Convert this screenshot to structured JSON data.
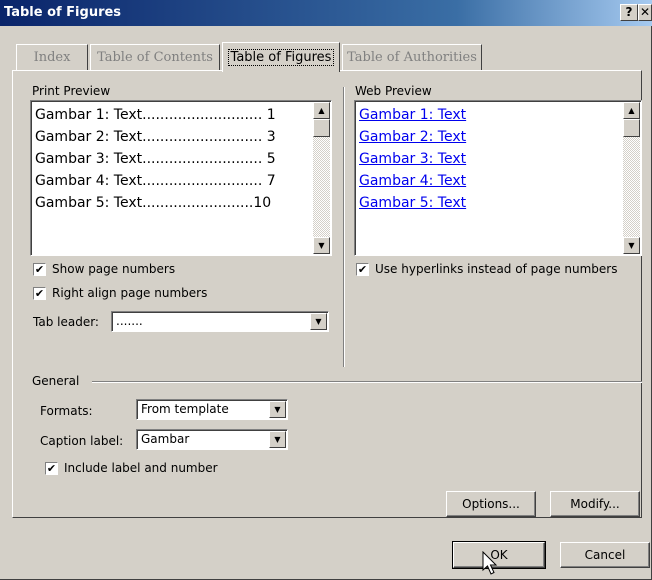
{
  "window": {
    "title": "Table of Figures",
    "help_glyph": "?",
    "close_glyph": "✕"
  },
  "tabs": [
    {
      "label": "Index",
      "active": false
    },
    {
      "label": "Table of Contents",
      "active": false
    },
    {
      "label": "Table of Figures",
      "active": true
    },
    {
      "label": "Table of Authorities",
      "active": false
    }
  ],
  "print_preview": {
    "label": "Print Preview",
    "lines": [
      "Gambar 1: Text........................... 1",
      "Gambar 2: Text........................... 3",
      "Gambar 3: Text........................... 5",
      "Gambar 4: Text........................... 7",
      "Gambar 5: Text.........................10"
    ]
  },
  "web_preview": {
    "label": "Web Preview",
    "links": [
      "Gambar 1: Text",
      "Gambar 2: Text",
      "Gambar 3: Text",
      "Gambar 4: Text",
      "Gambar 5: Text"
    ]
  },
  "options": {
    "show_page_numbers": {
      "label": "Show page numbers",
      "checked": true
    },
    "right_align": {
      "label": "Right align page numbers",
      "checked": true
    },
    "use_hyperlinks": {
      "label": "Use hyperlinks instead of page numbers",
      "checked": true
    },
    "tab_leader": {
      "label": "Tab leader:",
      "value": "......."
    }
  },
  "general": {
    "label": "General",
    "formats": {
      "label": "Formats:",
      "value": "From template"
    },
    "caption_label": {
      "label": "Caption label:",
      "value": "Gambar"
    },
    "include_label": {
      "label": "Include label and number",
      "checked": true
    }
  },
  "buttons": {
    "options": "Options...",
    "modify": "Modify...",
    "ok": "OK",
    "cancel": "Cancel"
  },
  "glyphs": {
    "check": "✔",
    "arrow_up": "▲",
    "arrow_down": "▼"
  }
}
